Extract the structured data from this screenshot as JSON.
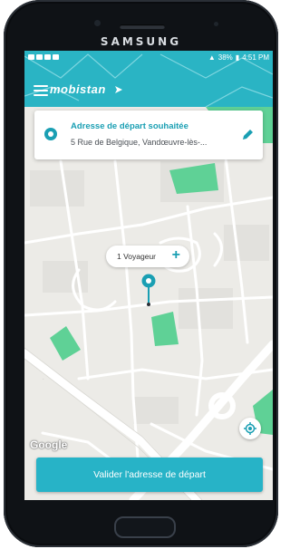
{
  "device": {
    "brand": "SAMSUNG"
  },
  "status_bar": {
    "battery": "38%",
    "time": "4:51 PM"
  },
  "header": {
    "logo_text": "mobistan"
  },
  "start_address": {
    "title": "Adresse de départ souhaitée",
    "address": "5 Rue de Belgique, Vandœuvre-lès-..."
  },
  "passengers": {
    "label": "1 Voyageur",
    "add_symbol": "+"
  },
  "map": {
    "attribution": "Google"
  },
  "actions": {
    "confirm_label": "Valider l'adresse de départ"
  },
  "colors": {
    "accent": "#27b3c7",
    "accent_dark": "#1a9fb3",
    "park_green": "#5fd196",
    "map_bg": "#ecebe7"
  }
}
